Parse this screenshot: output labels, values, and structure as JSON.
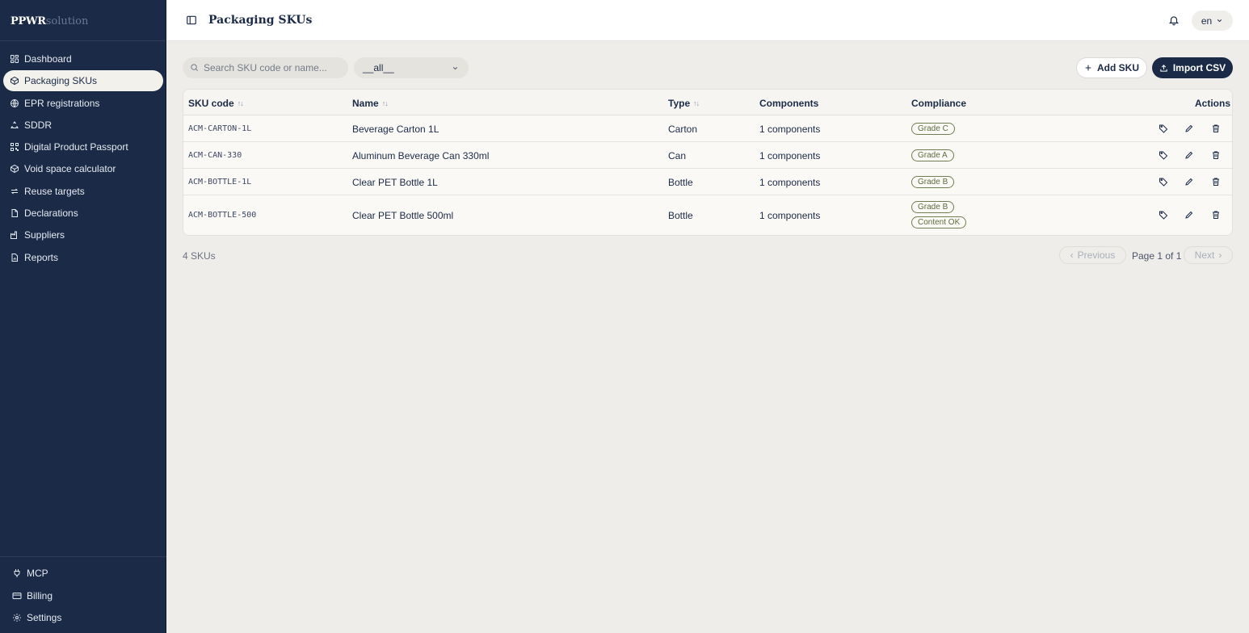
{
  "brand": {
    "part1": "PPWR",
    "part2": "solution"
  },
  "header": {
    "title": "Packaging SKUs",
    "language": "en"
  },
  "sidebar": {
    "items": [
      {
        "label": "Dashboard",
        "icon": "dashboard-icon"
      },
      {
        "label": "Packaging SKUs",
        "icon": "box-icon",
        "active": true
      },
      {
        "label": "EPR registrations",
        "icon": "globe-icon"
      },
      {
        "label": "SDDR",
        "icon": "recycle-icon"
      },
      {
        "label": "Digital Product Passport",
        "icon": "qr-code-icon"
      },
      {
        "label": "Void space calculator",
        "icon": "box-icon"
      },
      {
        "label": "Reuse targets",
        "icon": "repeat-icon"
      },
      {
        "label": "Declarations",
        "icon": "file-icon"
      },
      {
        "label": "Suppliers",
        "icon": "factory-icon"
      },
      {
        "label": "Reports",
        "icon": "report-icon"
      }
    ],
    "bottom": [
      {
        "label": "MCP",
        "icon": "plug-icon"
      },
      {
        "label": "Billing",
        "icon": "credit-card-icon"
      },
      {
        "label": "Settings",
        "icon": "gear-icon"
      }
    ]
  },
  "toolbar": {
    "search_placeholder": "Search SKU code or name...",
    "filter_value": "__all__",
    "add_label": "Add SKU",
    "import_label": "Import CSV"
  },
  "table": {
    "columns": [
      "SKU code",
      "Name",
      "Type",
      "Components",
      "Compliance",
      "Actions"
    ],
    "rows": [
      {
        "code": "ACM-CARTON-1L",
        "name": "Beverage Carton 1L",
        "type": "Carton",
        "components": "1 components",
        "badges": [
          "Grade C"
        ]
      },
      {
        "code": "ACM-CAN-330",
        "name": "Aluminum Beverage Can 330ml",
        "type": "Can",
        "components": "1 components",
        "badges": [
          "Grade A"
        ]
      },
      {
        "code": "ACM-BOTTLE-1L",
        "name": "Clear PET Bottle 1L",
        "type": "Bottle",
        "components": "1 components",
        "badges": [
          "Grade B"
        ]
      },
      {
        "code": "ACM-BOTTLE-500",
        "name": "Clear PET Bottle 500ml",
        "type": "Bottle",
        "components": "1 components",
        "badges": [
          "Grade B",
          "Content OK"
        ]
      }
    ]
  },
  "footer": {
    "count": "4 SKUs",
    "prev": "Previous",
    "page_info": "Page 1 of 1",
    "next": "Next"
  },
  "colors": {
    "sidebar": "#1b2a46",
    "accent": "#1b2a46",
    "badge": "#6f7f52",
    "background": "#eeede9"
  }
}
